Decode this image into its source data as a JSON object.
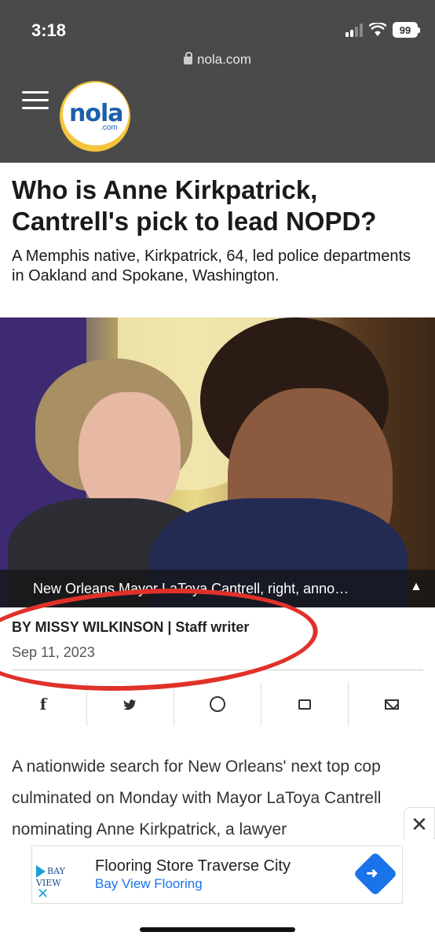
{
  "status_bar": {
    "time": "3:18",
    "battery": "99"
  },
  "browser": {
    "url": "nola.com"
  },
  "site": {
    "logo_text": "nola",
    "logo_sub": ".com"
  },
  "article": {
    "headline": "Who is Anne Kirkpatrick, Cantrell's pick to lead NOPD?",
    "subhead": "A Memphis native, Kirkpatrick, 64, led police departments in Oakland and Spokane, Washington.",
    "photo_caption": "New Orleans Mayor LaToya Cantrell, right, anno…",
    "caption_toggle": "▲",
    "byline": "BY MISSY WILKINSON | Staff writer",
    "date": "Sep 11, 2023",
    "body_part1": "A nationwide search for New Orleans' next top cop culminated on Monday with ",
    "body_link": "Mayor LaToya Cantrell nominating Anne Kirkpatrick",
    "body_part2": ", a lawyer"
  },
  "share": {
    "facebook": "f",
    "twitter": "🐦",
    "whatsapp": "",
    "comment": "",
    "email": ""
  },
  "ad": {
    "logo_text": "BAY VIEW",
    "title": "Flooring Store Traverse City",
    "subtitle": "Bay View Flooring",
    "close": "✕"
  },
  "overlay_close": "✕"
}
